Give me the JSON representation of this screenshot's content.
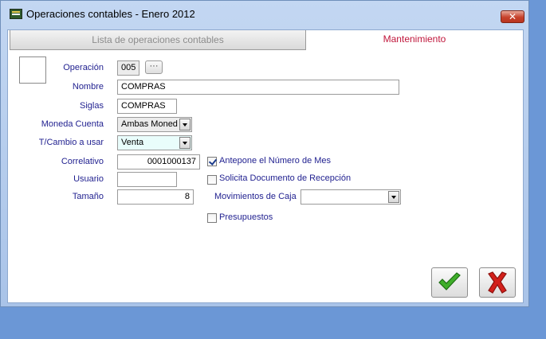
{
  "window": {
    "title": "Operaciones contables - Enero 2012",
    "close_icon": "close-icon",
    "app_icon": "app-icon"
  },
  "tabs": [
    {
      "label": "Lista de operaciones contables",
      "active": false
    },
    {
      "label": "Mantenimiento",
      "active": true
    }
  ],
  "form": {
    "operacion": {
      "label": "Operación",
      "value": "005",
      "lookup_label": "···"
    },
    "nombre": {
      "label": "Nombre",
      "value": "COMPRAS"
    },
    "siglas": {
      "label": "Siglas",
      "value": "COMPRAS"
    },
    "moneda_cuenta": {
      "label": "Moneda Cuenta",
      "value": "Ambas Moned"
    },
    "tcambio": {
      "label": "T/Cambio a usar",
      "value": "Venta"
    },
    "correlativo": {
      "label": "Correlativo",
      "value": "0001000137"
    },
    "usuario": {
      "label": "Usuario",
      "value": ""
    },
    "tamano": {
      "label": "Tamaño",
      "value": "8"
    },
    "antepone_mes": {
      "label": "Antepone el Número de Mes",
      "checked": true
    },
    "solicita_doc": {
      "label": "Solicita Documento de Recepción",
      "checked": false
    },
    "movimientos_caja": {
      "label": "Movimientos de Caja",
      "value": ""
    },
    "presupuestos": {
      "label": "Presupuestos",
      "checked": false
    }
  },
  "actions": {
    "accept_icon": "checkmark-icon",
    "cancel_icon": "x-icon"
  },
  "colors": {
    "label": "#1f1f8f",
    "active_tab": "#c0163b",
    "accept": "#3fae2a",
    "cancel": "#d3201b",
    "desktop": "#6b97d6"
  }
}
